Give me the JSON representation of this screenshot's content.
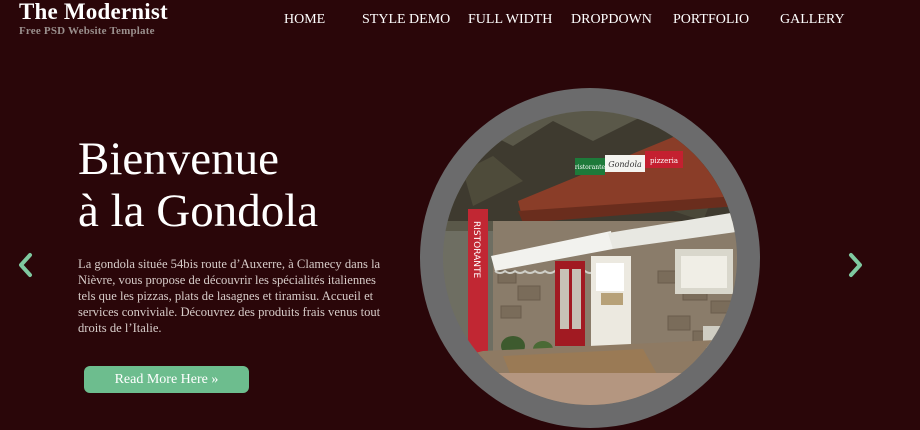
{
  "site": {
    "title": "The Modernist",
    "tagline": "Free PSD Website Template"
  },
  "nav": {
    "items": [
      {
        "label": "HOME"
      },
      {
        "label": "STYLE DEMO"
      },
      {
        "label": "FULL WIDTH"
      },
      {
        "label": "DROPDOWN"
      },
      {
        "label": "PORTFOLIO"
      },
      {
        "label": "GALLERY"
      }
    ]
  },
  "hero": {
    "title_line1": "Bienvenue",
    "title_line2": "à la Gondola",
    "description": "La gondola située 54bis route d’Auxerre, à Clamecy dans la Nièvre, vous propose de découvrir les spécialités italiennes tels que les pizzas, plats de lasagnes et tiramisu. Accueil et services conviviale. Découvrez des produits frais venus tout droits de l’Italie.",
    "cta_label": "Read More Here »"
  },
  "photo": {
    "sign_left": "ristorante",
    "sign_center": "Gondola",
    "sign_right": "pizzeria",
    "banner_text": "RISTORANTE"
  },
  "colors": {
    "background": "#2a0609",
    "accent_button": "#6dbd8e",
    "arrow": "#7fc9a0",
    "frame": "#6b6b6c"
  },
  "icons": {
    "prev": "chevron-left-icon",
    "next": "chevron-right-icon"
  }
}
